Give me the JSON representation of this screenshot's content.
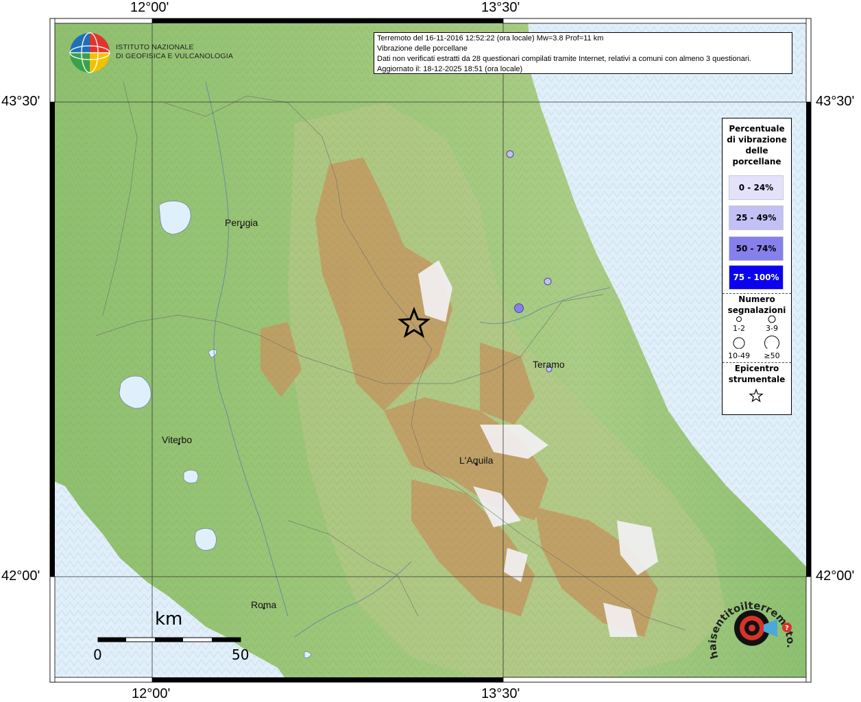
{
  "axes": {
    "top_left": "12°00'",
    "top_right": "13°30'",
    "bottom_left": "12°00'",
    "bottom_right": "13°30'",
    "left_top": "43°30'",
    "left_bottom": "42°00'",
    "right_top": "43°30'",
    "right_bottom": "42°00'"
  },
  "logo": {
    "line1": "ISTITUTO NAZIONALE",
    "line2": "DI GEOFISICA E VULCANOLOGIA"
  },
  "info": {
    "line1": "Terremoto del 16-11-2016 12:52:22 (ora locale) Mw=3.8 Prof=11 km",
    "line2": "Vibrazione delle porcellane",
    "line3": "Dati non verificati estratti da 28 questionari compilati tramite Internet, relativi a comuni con almeno 3 questionari.",
    "line4": "Aggiornato il: 18-12-2025 18:51 (ora locale)"
  },
  "cities": {
    "perugia": "Perugia",
    "teramo": "Teramo",
    "viterbo": "Viterbo",
    "laquila": "L'Aquila",
    "roma": "Roma"
  },
  "legend": {
    "title": "Percentuale di vibrazione delle porcellane",
    "title_lines": [
      "Percentuale",
      "di vibrazione",
      "delle",
      "porcellane"
    ],
    "bins": [
      {
        "label": "0 - 24%",
        "color": "#e4e2fb",
        "text_color": "#000000"
      },
      {
        "label": "25 - 49%",
        "color": "#c3c0f5",
        "text_color": "#000000"
      },
      {
        "label": "50 - 74%",
        "color": "#8580ec",
        "text_color": "#000000"
      },
      {
        "label": "75 - 100%",
        "color": "#0c02f0",
        "text_color": "#ffffff"
      }
    ],
    "count_title_lines": [
      "Numero",
      "segnalazioni"
    ],
    "sizes": [
      "1-2",
      "3-9",
      "10-49",
      "≥50"
    ],
    "epicenter_lines": [
      "Epicentro",
      "strumentale"
    ]
  },
  "scale": {
    "unit": "km",
    "min": "0",
    "max": "50"
  },
  "observations": [
    {
      "bin": 0,
      "size": 1
    },
    {
      "bin": 0,
      "size": 1
    },
    {
      "bin": 1,
      "size": 1
    },
    {
      "bin": 2,
      "size": 2
    }
  ],
  "colors": {
    "sea": "#dfeffb",
    "lowland": "#86bd6a",
    "hill": "#b7c98a",
    "mountain": "#b8915a",
    "peak": "#f3f1f4"
  },
  "watermark": "haisentitoilterremoto.it"
}
